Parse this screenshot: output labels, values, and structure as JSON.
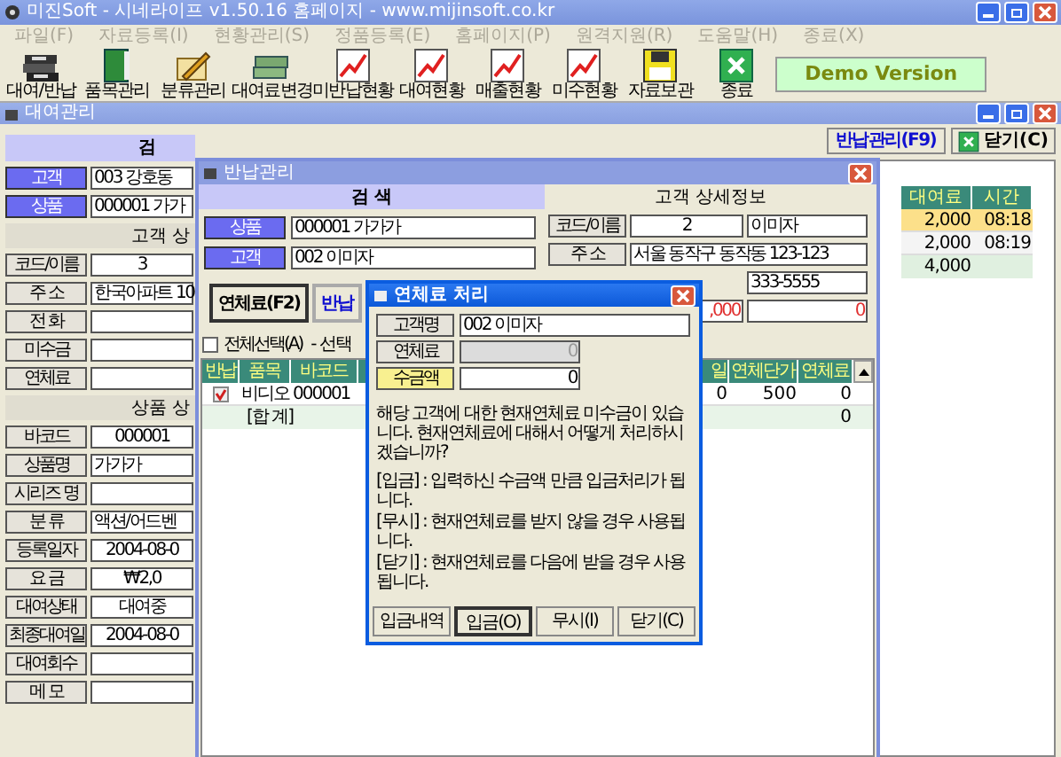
{
  "window": {
    "title": "미진Soft - 시네라이프 v1.50.16 홈페이지 - www.mijinsoft.co.kr",
    "menu": [
      {
        "label": "파일(F)",
        "disabled": true
      },
      {
        "label": "자료등록(I)",
        "disabled": true
      },
      {
        "label": "현황관리(S)",
        "disabled": true
      },
      {
        "label": "정품등록(E)",
        "disabled": true
      },
      {
        "label": "홈페이지(P)",
        "disabled": true
      },
      {
        "label": "원격지원(R)",
        "disabled": true
      },
      {
        "label": "도움말(H)",
        "disabled": true
      },
      {
        "label": "종료(X)",
        "disabled": true
      }
    ],
    "toolbar": [
      {
        "label": "대여/반납",
        "kind": "tapes"
      },
      {
        "label": "품목관리",
        "kind": "book"
      },
      {
        "label": "분류관리",
        "kind": "pencil"
      },
      {
        "label": "대여료변경",
        "kind": "money"
      },
      {
        "label": "미반납현황",
        "kind": "chart"
      },
      {
        "label": "대여현황",
        "kind": "chart"
      },
      {
        "label": "매출현황",
        "kind": "chart"
      },
      {
        "label": "미수현황",
        "kind": "chart"
      },
      {
        "label": "자료보관",
        "kind": "disk"
      },
      {
        "label": "종료",
        "kind": "exit"
      }
    ],
    "badge": "Demo Version"
  },
  "rental_window": {
    "title": "대여관리",
    "return_button": "반납관리(F9)",
    "close_button": "닫기(C)",
    "search_header": "검",
    "fields": [
      {
        "label": "고객",
        "value": "003 강호동"
      },
      {
        "label": "상품",
        "value": "000001 가가"
      }
    ],
    "customer_header": "고객 상",
    "customer_fields": [
      {
        "label": "코드/이름",
        "value": "3"
      },
      {
        "label": "주 소",
        "value": "한국아파트 10"
      },
      {
        "label": "전 화"
      },
      {
        "label": "미수금"
      },
      {
        "label": "연체료"
      }
    ],
    "product_header": "상품 상",
    "product_fields": [
      {
        "label": "바코드",
        "value": "000001"
      },
      {
        "label": "상품명",
        "value": "가가가"
      },
      {
        "label": "시리즈 명"
      },
      {
        "label": "분 류",
        "value": "액션/어드벤"
      },
      {
        "label": "등록일자",
        "value": "2004-08-0"
      },
      {
        "label": "요 금",
        "value": "₩2,0"
      },
      {
        "label": "대여상태",
        "value": "대여중"
      },
      {
        "label": "최종대여일",
        "value": "2004-08-0"
      },
      {
        "label": "대여회수"
      },
      {
        "label": "메 모"
      }
    ],
    "grid": {
      "columns": [
        "대여료",
        "시간"
      ],
      "rows": [
        {
          "cells": [
            "2,000",
            "08:18"
          ],
          "selected": true
        },
        {
          "cells": [
            "2,000",
            "08:19"
          ],
          "selected": false
        }
      ],
      "total": "4,000"
    }
  },
  "return_window": {
    "title": "반납관리",
    "search_header": "검 색",
    "detail_header": "고객 상세정보",
    "fields": [
      {
        "label": "상품",
        "value": "000001 가가가"
      },
      {
        "label": "고객",
        "value": "002 이미자"
      }
    ],
    "buttons": [
      {
        "label": "연체료(F2)",
        "kind": "normal"
      },
      {
        "label": "반납",
        "kind": "link"
      }
    ],
    "select_all": {
      "label": "전체선택(A)",
      "checked": false
    },
    "select_note": "- 선택",
    "grid": {
      "check_column": "반납",
      "columns": [
        "품목",
        "바코드"
      ],
      "right_columns": [
        "일",
        "연체단가",
        "연체료"
      ],
      "rows": [
        {
          "checked": true,
          "cells": [
            "비디오",
            "000001"
          ],
          "right_cells": [
            "0",
            "500",
            "0"
          ]
        }
      ],
      "total_label": "[합 계]",
      "total": "0"
    },
    "detail": [
      {
        "label": "코드/이름",
        "values": [
          "2",
          "이미자"
        ]
      },
      {
        "label": "주 소",
        "values": [
          "서울 동작구 동작동 123-123"
        ]
      },
      {
        "values": [
          "333-5555"
        ]
      },
      {
        "values": [
          ",000",
          "0"
        ]
      }
    ]
  },
  "dialog": {
    "title": "연체료 처리",
    "fields": [
      {
        "label": "고객명",
        "value": "002 이미자",
        "kind": "text"
      },
      {
        "label": "연체료",
        "value": "0",
        "kind": "disabled"
      },
      {
        "label": "수금액",
        "value": "0",
        "kind": "highlight"
      }
    ],
    "message": "해당 고객에 대한 현재연체료 미수금이 있습니다. 현재연체료에 대해서 어떻게 처리하시겠습니까?",
    "notes": [
      "[입금] : 입력하신 수금액 만큼 입금처리가 됩니다.",
      "[무시] : 현재연체료를 받지 않을 경우 사용됩니다.",
      "[닫기] : 현재연체료를 다음에 받을 경우 사용됩니다."
    ],
    "buttons": [
      {
        "label": "입금내역",
        "focused": false
      },
      {
        "label": "입금(O)",
        "focused": true
      },
      {
        "label": "무시(I)",
        "focused": false
      },
      {
        "label": "닫기(C)",
        "focused": false
      }
    ]
  }
}
